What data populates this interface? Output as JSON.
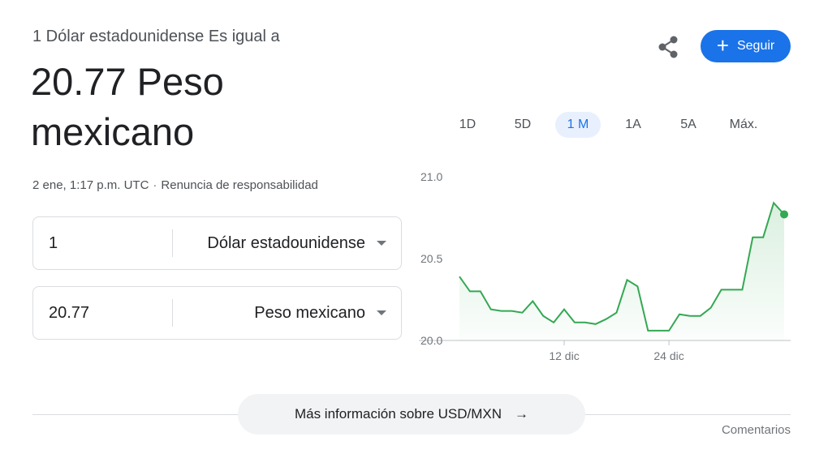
{
  "header": {
    "subtitle": "1 Dólar estadounidense Es igual a",
    "value_line": "20.77 Peso mexicano",
    "timestamp": "2 ene, 1:17 p.m. UTC",
    "separator": "·",
    "disclaimer": "Renuncia de responsabilidad"
  },
  "converter": {
    "from": {
      "amount": "1",
      "currency": "Dólar estadounidense"
    },
    "to": {
      "amount": "20.77",
      "currency": "Peso mexicano"
    }
  },
  "actions": {
    "follow_label": "Seguir",
    "follow_plus": "+"
  },
  "range_tabs": [
    {
      "label": "1D",
      "active": false
    },
    {
      "label": "5D",
      "active": false
    },
    {
      "label": "1 M",
      "active": true
    },
    {
      "label": "1A",
      "active": false
    },
    {
      "label": "5A",
      "active": false
    },
    {
      "label": "Máx.",
      "active": false
    }
  ],
  "chart_data": {
    "type": "area",
    "y_tick_labels": [
      "20.0",
      "20.5",
      "21.0"
    ],
    "y_ticks": [
      20.0,
      20.5,
      21.0
    ],
    "ylim": [
      20.0,
      21.0
    ],
    "x_tick_labels": [
      "12 dic",
      "24 dic"
    ],
    "x_tick_index": [
      10,
      20
    ],
    "values": [
      20.39,
      20.3,
      20.3,
      20.19,
      20.18,
      20.18,
      20.17,
      20.24,
      20.15,
      20.11,
      20.19,
      20.11,
      20.11,
      20.1,
      20.13,
      20.17,
      20.37,
      20.33,
      20.06,
      20.06,
      20.06,
      20.16,
      20.15,
      20.15,
      20.2,
      20.31,
      20.31,
      20.31,
      20.63,
      20.63,
      20.84,
      20.77
    ],
    "line_color": "#34a853",
    "fill_color": "#e6f4ea",
    "grid": false
  },
  "footer": {
    "more_info": "Más información sobre USD/MXN",
    "arrow": "→",
    "comments": "Comentarios"
  }
}
